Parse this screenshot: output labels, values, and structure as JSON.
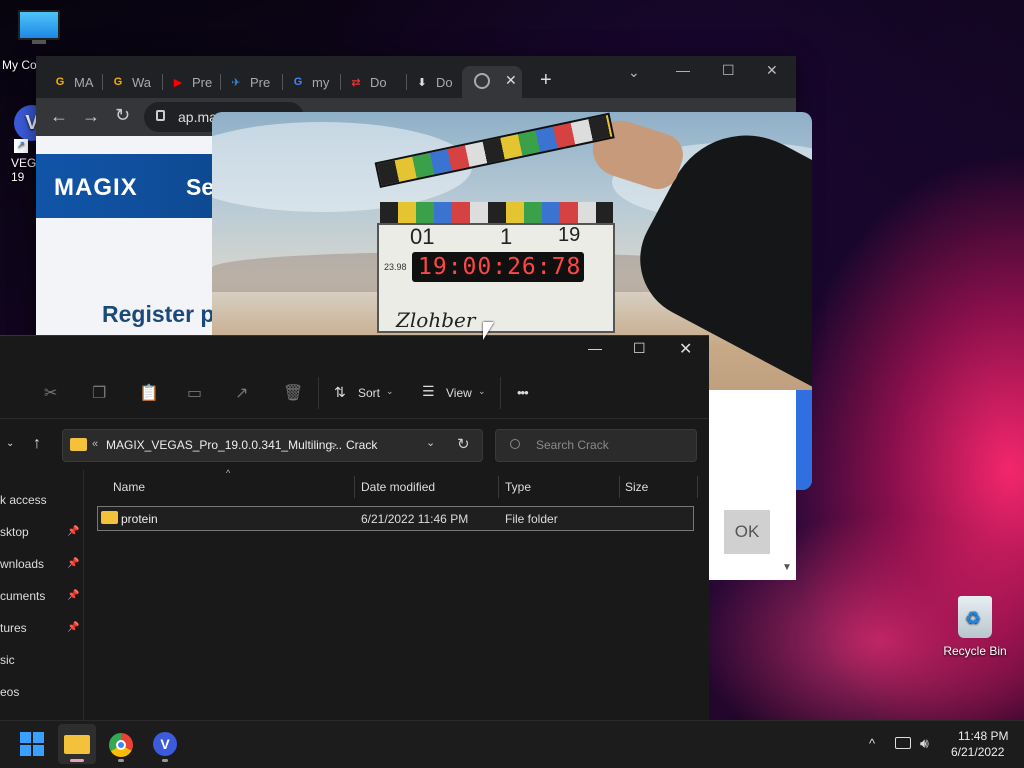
{
  "desktop": {
    "icons": [
      {
        "label": "My Co",
        "name": "this-pc"
      },
      {
        "label": "VEGA\n19",
        "name": "vegas-shortcut"
      },
      {
        "label": "Recycle Bin",
        "name": "recycle-bin"
      }
    ]
  },
  "browser": {
    "tabs": [
      {
        "label": "MA",
        "icon": "G",
        "color": "#f2b200"
      },
      {
        "label": "Wa",
        "icon": "G",
        "color": "#f2b200"
      },
      {
        "label": "Pre",
        "icon": "▶",
        "color": "#ff0000"
      },
      {
        "label": "Pre",
        "icon": "✈",
        "color": "#2d8fe0"
      },
      {
        "label": "my",
        "icon": "G",
        "color": "#4285f4"
      },
      {
        "label": "Do",
        "icon": "⇄",
        "color": "#e33"
      },
      {
        "label": "Do",
        "icon": "⬇",
        "color": "#ddd"
      }
    ],
    "url": "ap.mag",
    "page": {
      "logo": "MAGIX",
      "nav_text": "Se",
      "heading": "Register p"
    }
  },
  "video": {
    "clapper": {
      "roll": "01",
      "scene": "1",
      "take": "19",
      "timecode": "19:00:26:78",
      "name": "Zlohber",
      "fps": "23.98"
    }
  },
  "dialog": {
    "ok_label": "OK"
  },
  "explorer": {
    "toolbar": {
      "sort_label": "Sort",
      "view_label": "View",
      "more_label": "•••"
    },
    "breadcrumb": {
      "prefix": "«",
      "folder": "MAGIX_VEGAS_Pro_19.0.0.341_Multiling...",
      "sep": ">",
      "current": "Crack"
    },
    "search_placeholder": "Search Crack",
    "sidebar": [
      {
        "label": "k access",
        "pinned": false
      },
      {
        "label": "sktop",
        "pinned": true
      },
      {
        "label": "wnloads",
        "pinned": true
      },
      {
        "label": "cuments",
        "pinned": true
      },
      {
        "label": "tures",
        "pinned": true
      },
      {
        "label": "sic",
        "pinned": false
      },
      {
        "label": "eos",
        "pinned": false
      }
    ],
    "columns": {
      "name": "Name",
      "date": "Date modified",
      "type": "Type",
      "size": "Size"
    },
    "rows": [
      {
        "name": "protein",
        "date": "6/21/2022 11:46 PM",
        "type": "File folder",
        "size": ""
      }
    ]
  },
  "taskbar": {
    "time": "11:48 PM",
    "date": "6/21/2022"
  }
}
